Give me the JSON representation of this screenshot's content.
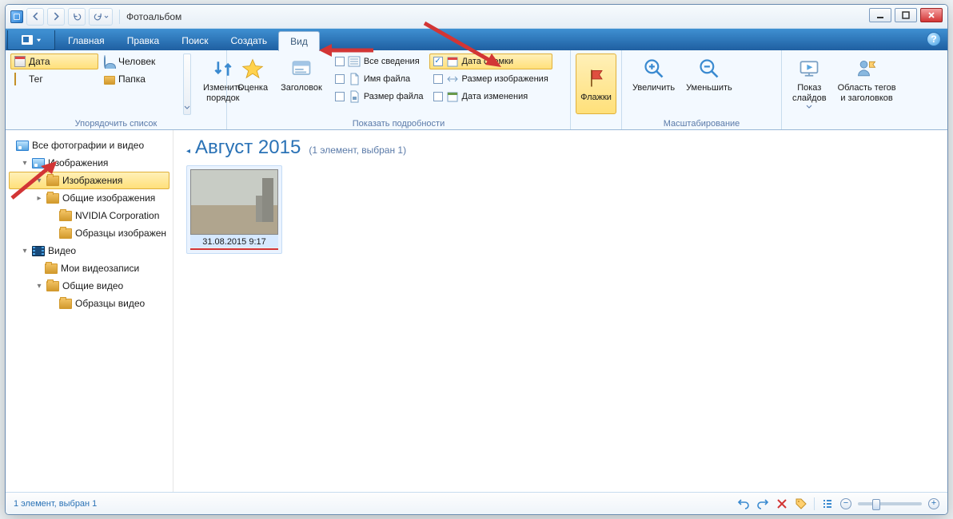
{
  "window": {
    "title": "Фотоальбом"
  },
  "tabs": {
    "main": "Главная",
    "edit": "Правка",
    "search": "Поиск",
    "create": "Создать",
    "view": "Вид"
  },
  "ribbon": {
    "arrange": {
      "label": "Упорядочить список",
      "date": "Дата",
      "tag": "Тег",
      "person": "Человек",
      "folder": "Папка",
      "reorder": "Изменить\nпорядок"
    },
    "rating": {
      "label": "Оценка"
    },
    "caption": {
      "label": "Заголовок"
    },
    "details": {
      "group_label": "Показать подробности",
      "all": "Все сведения",
      "filename": "Имя файла",
      "filesize": "Размер файла",
      "date_taken": "Дата съемки",
      "dimensions": "Размер изображения",
      "date_modified": "Дата изменения"
    },
    "flags": {
      "label": "Флажки"
    },
    "zoom": {
      "group_label": "Масштабирование",
      "in": "Увеличить",
      "out": "Уменьшить"
    },
    "slideshow": {
      "label": "Показ\nслайдов"
    },
    "tagarea": {
      "label": "Область тегов\nи заголовков"
    }
  },
  "tree": {
    "all": "Все фотографии и видео",
    "images": "Изображения",
    "images_sel": "Изображения",
    "public_images": "Общие изображения",
    "nvidia": "NVIDIA Corporation",
    "sample_images": "Образцы изображен",
    "video": "Видео",
    "my_video": "Мои видеозаписи",
    "public_video": "Общие видео",
    "sample_video": "Образцы видео"
  },
  "gallery": {
    "month": "Август 2015",
    "count": "(1 элемент, выбран 1)",
    "thumb_caption": "31.08.2015 9:17"
  },
  "status": {
    "text": "1 элемент, выбран 1"
  }
}
